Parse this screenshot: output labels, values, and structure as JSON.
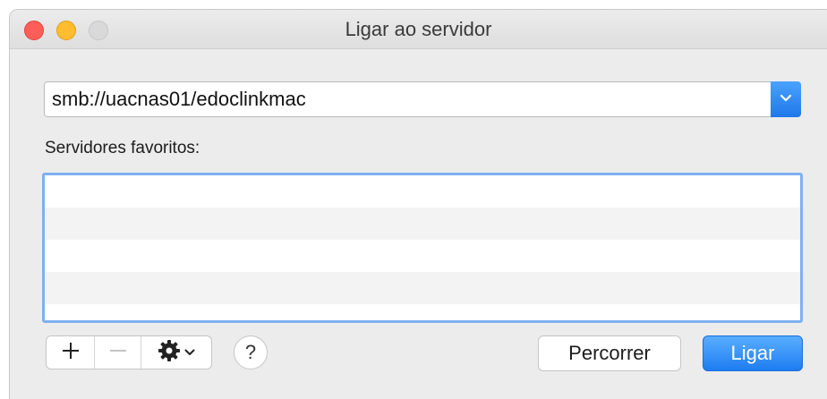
{
  "window": {
    "title": "Ligar ao servidor"
  },
  "server": {
    "address_value": "smb://uacnas01/edoclinkmac"
  },
  "favorites": {
    "label": "Servidores favoritos:",
    "items": []
  },
  "toolbar": {
    "add_icon": "plus-icon",
    "remove_icon": "minus-icon",
    "action_icon": "gear-icon",
    "help_label": "?"
  },
  "buttons": {
    "browse_label": "Percorrer",
    "connect_label": "Ligar"
  },
  "colors": {
    "accent": "#1f78e8",
    "close": "#fd5e57",
    "minimize": "#febc2e",
    "zoom_disabled": "#d9d9d9"
  }
}
